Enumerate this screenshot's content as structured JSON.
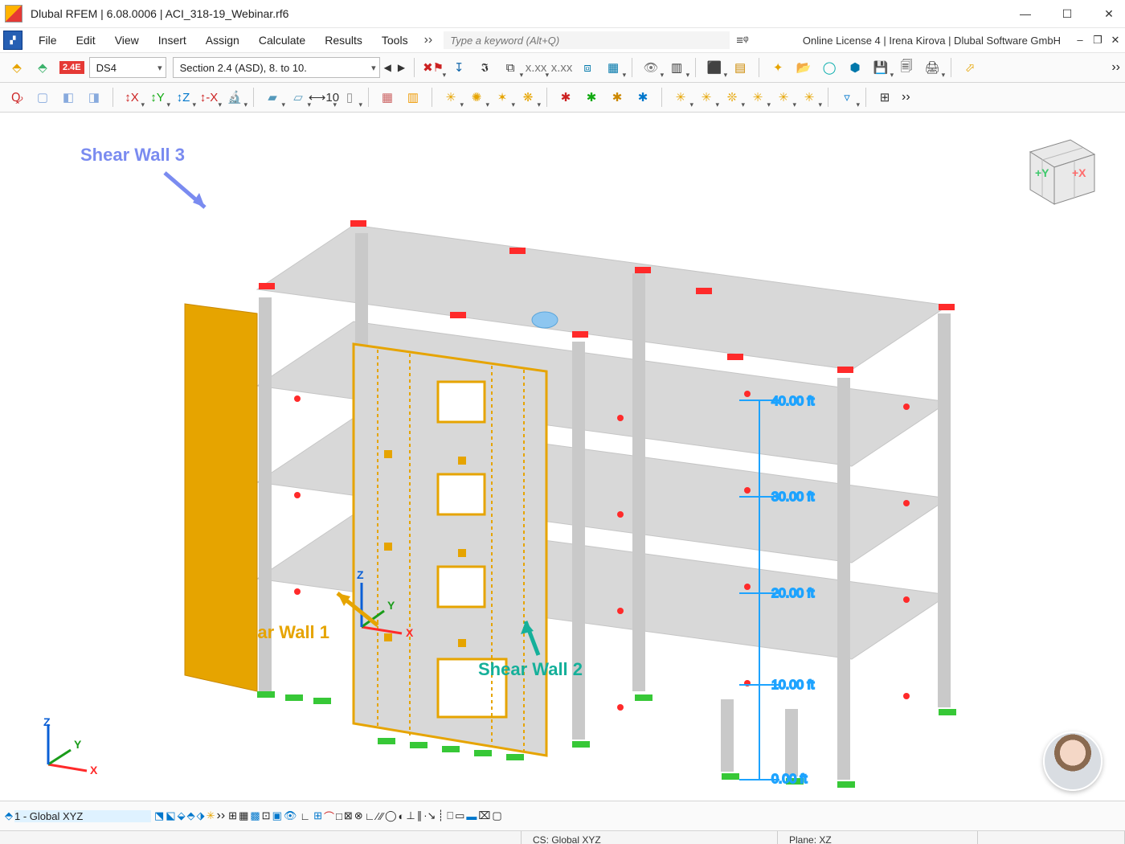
{
  "window": {
    "title": "Dlubal RFEM | 6.08.0006 | ACI_318-19_Webinar.rf6",
    "license": "Online License 4 | Irena Kirova | Dlubal Software GmbH"
  },
  "menu": {
    "items": [
      "File",
      "Edit",
      "View",
      "Insert",
      "Assign",
      "Calculate",
      "Results",
      "Tools"
    ]
  },
  "search": {
    "placeholder": "Type a keyword (Alt+Q)"
  },
  "toolbar1": {
    "load_tag": "2.4E",
    "design_situation": "DS4",
    "load_case": "Section 2.4 (ASD), 8. to 10."
  },
  "annotations": {
    "sw1": "Shear Wall 1",
    "sw2": "Shear Wall 2",
    "sw3": "Shear Wall 3"
  },
  "dimensions": {
    "levels": [
      "40.00 ft",
      "30.00 ft",
      "20.00 ft",
      "10.00 ft",
      "0.00 ft"
    ]
  },
  "axes": {
    "x": "X",
    "y": "Y",
    "z": "Z"
  },
  "nav_cube": {
    "pos_x": "+X",
    "pos_y": "+Y"
  },
  "bottombar": {
    "workplane": "1 - Global XYZ"
  },
  "status": {
    "cs": "CS: Global XYZ",
    "plane": "Plane: XZ"
  }
}
